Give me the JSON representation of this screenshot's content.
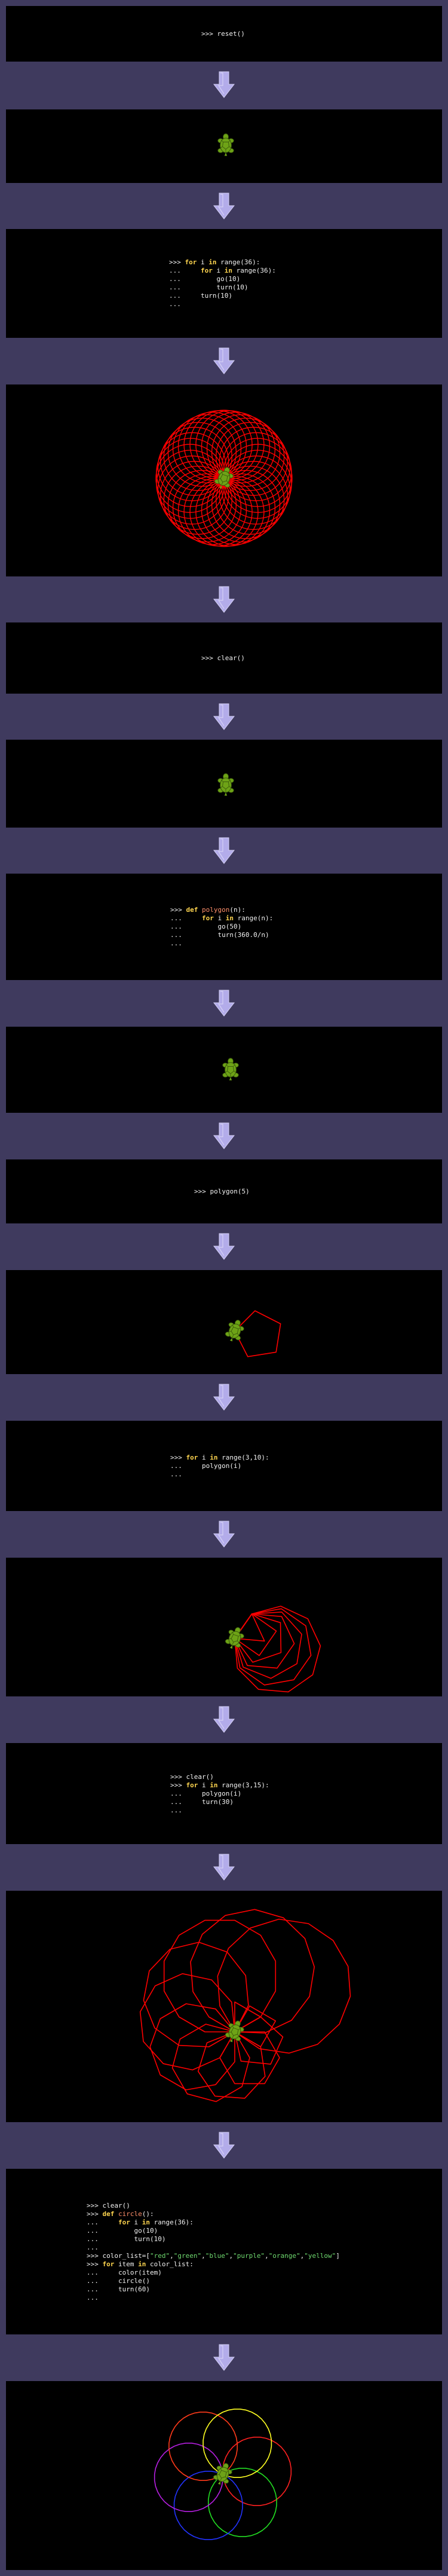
{
  "steps": [
    {
      "type": "code",
      "lines": [
        ">>> reset()"
      ]
    },
    {
      "type": "canvas",
      "drawing": "turtle-only"
    },
    {
      "type": "code",
      "lines": [
        ">>> for i in range(36):",
        "...     for i in range(36):",
        "...         go(10)",
        "...         turn(10)",
        "...     turn(10)",
        "..."
      ]
    },
    {
      "type": "canvas",
      "drawing": "rosette-of-circles"
    },
    {
      "type": "code",
      "lines": [
        ">>> clear()"
      ]
    },
    {
      "type": "canvas",
      "drawing": "turtle-only"
    },
    {
      "type": "code",
      "lines": [
        ">>> def polygon(n):",
        "...     for i in range(n):",
        "...         go(50)",
        "...         turn(360.0/n)",
        "..."
      ]
    },
    {
      "type": "canvas",
      "drawing": "turtle-only"
    },
    {
      "type": "code",
      "lines": [
        ">>> polygon(5)"
      ]
    },
    {
      "type": "canvas",
      "drawing": "pentagon"
    },
    {
      "type": "code",
      "lines": [
        ">>> for i in range(3,10):",
        "...     polygon(i)",
        "..."
      ]
    },
    {
      "type": "canvas",
      "drawing": "nested-polygons"
    },
    {
      "type": "code",
      "lines": [
        ">>> clear()",
        ">>> for i in range(3,15):",
        "...     polygon(i)",
        "...     turn(30)",
        "..."
      ]
    },
    {
      "type": "canvas",
      "drawing": "rotated-polygons"
    },
    {
      "type": "code",
      "lines": [
        ">>> clear()",
        ">>> def circle():",
        "...     for i in range(36):",
        "...         go(10)",
        "...         turn(10)",
        "...",
        ">>> color_list=[\"red\",\"green\",\"blue\",\"purple\",\"orange\",\"yellow\"]",
        ">>> for item in color_list:",
        "...     color(item)",
        "...     circle()",
        "...     turn(60)",
        "..."
      ]
    },
    {
      "type": "canvas",
      "drawing": "colored-circles"
    }
  ],
  "keywords": [
    "for",
    "in",
    "def"
  ],
  "colors": {
    "background": "#3f3a5e",
    "panel": "#000000",
    "arrow": "#b3acea",
    "pen": "#ff0000",
    "turtle_body": "#6ea317",
    "keyword": "#ffd54f",
    "function_name": "#ff8f6b",
    "string": "#6fd96f"
  },
  "flower_colors": [
    "red",
    "green",
    "blue",
    "purple",
    "orange",
    "yellow"
  ],
  "icons": {
    "turtle": "turtle-icon",
    "arrow": "arrow-down-icon"
  }
}
